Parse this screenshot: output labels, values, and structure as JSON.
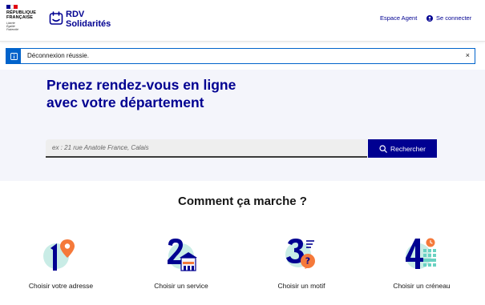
{
  "header": {
    "republic_line1": "RÉPUBLIQUE",
    "republic_line2": "FRANÇAISE",
    "devise_line1": "Liberté",
    "devise_line2": "Égalité",
    "devise_line3": "Fraternité",
    "app_name_line1": "RDV",
    "app_name_line2": "Solidarités",
    "agent_link": "Espace Agent",
    "login_link": "Se connecter",
    "icons": [
      "calendar-icon",
      "user-icon"
    ]
  },
  "alert": {
    "message": "Déconnexion réussie.",
    "close": "×",
    "icon": "info-icon"
  },
  "hero": {
    "title_line1": "Prenez rendez-vous en ligne",
    "title_line2": "avec votre département",
    "search_placeholder": "ex : 21 rue Anatole France, Calais",
    "search_button": "Rechercher"
  },
  "how_it_works": {
    "title": "Comment ça marche ?",
    "steps": [
      {
        "number": "1",
        "label": "Choisir votre adresse",
        "icon": "location-pin-icon"
      },
      {
        "number": "2",
        "label": "Choisir un service",
        "icon": "building-icon"
      },
      {
        "number": "3",
        "label": "Choisir un motif",
        "icon": "question-bubble-icon"
      },
      {
        "number": "4",
        "label": "Choisir un créneau",
        "icon": "calendar-slot-icon"
      }
    ]
  },
  "colors": {
    "primary": "#000091",
    "info": "#0063cb",
    "hero_bg": "#f4f5fb",
    "accent_orange": "#f5793a",
    "accent_teal": "#6ad2c2",
    "flag_blue": "#000091",
    "flag_red": "#e1000f"
  }
}
